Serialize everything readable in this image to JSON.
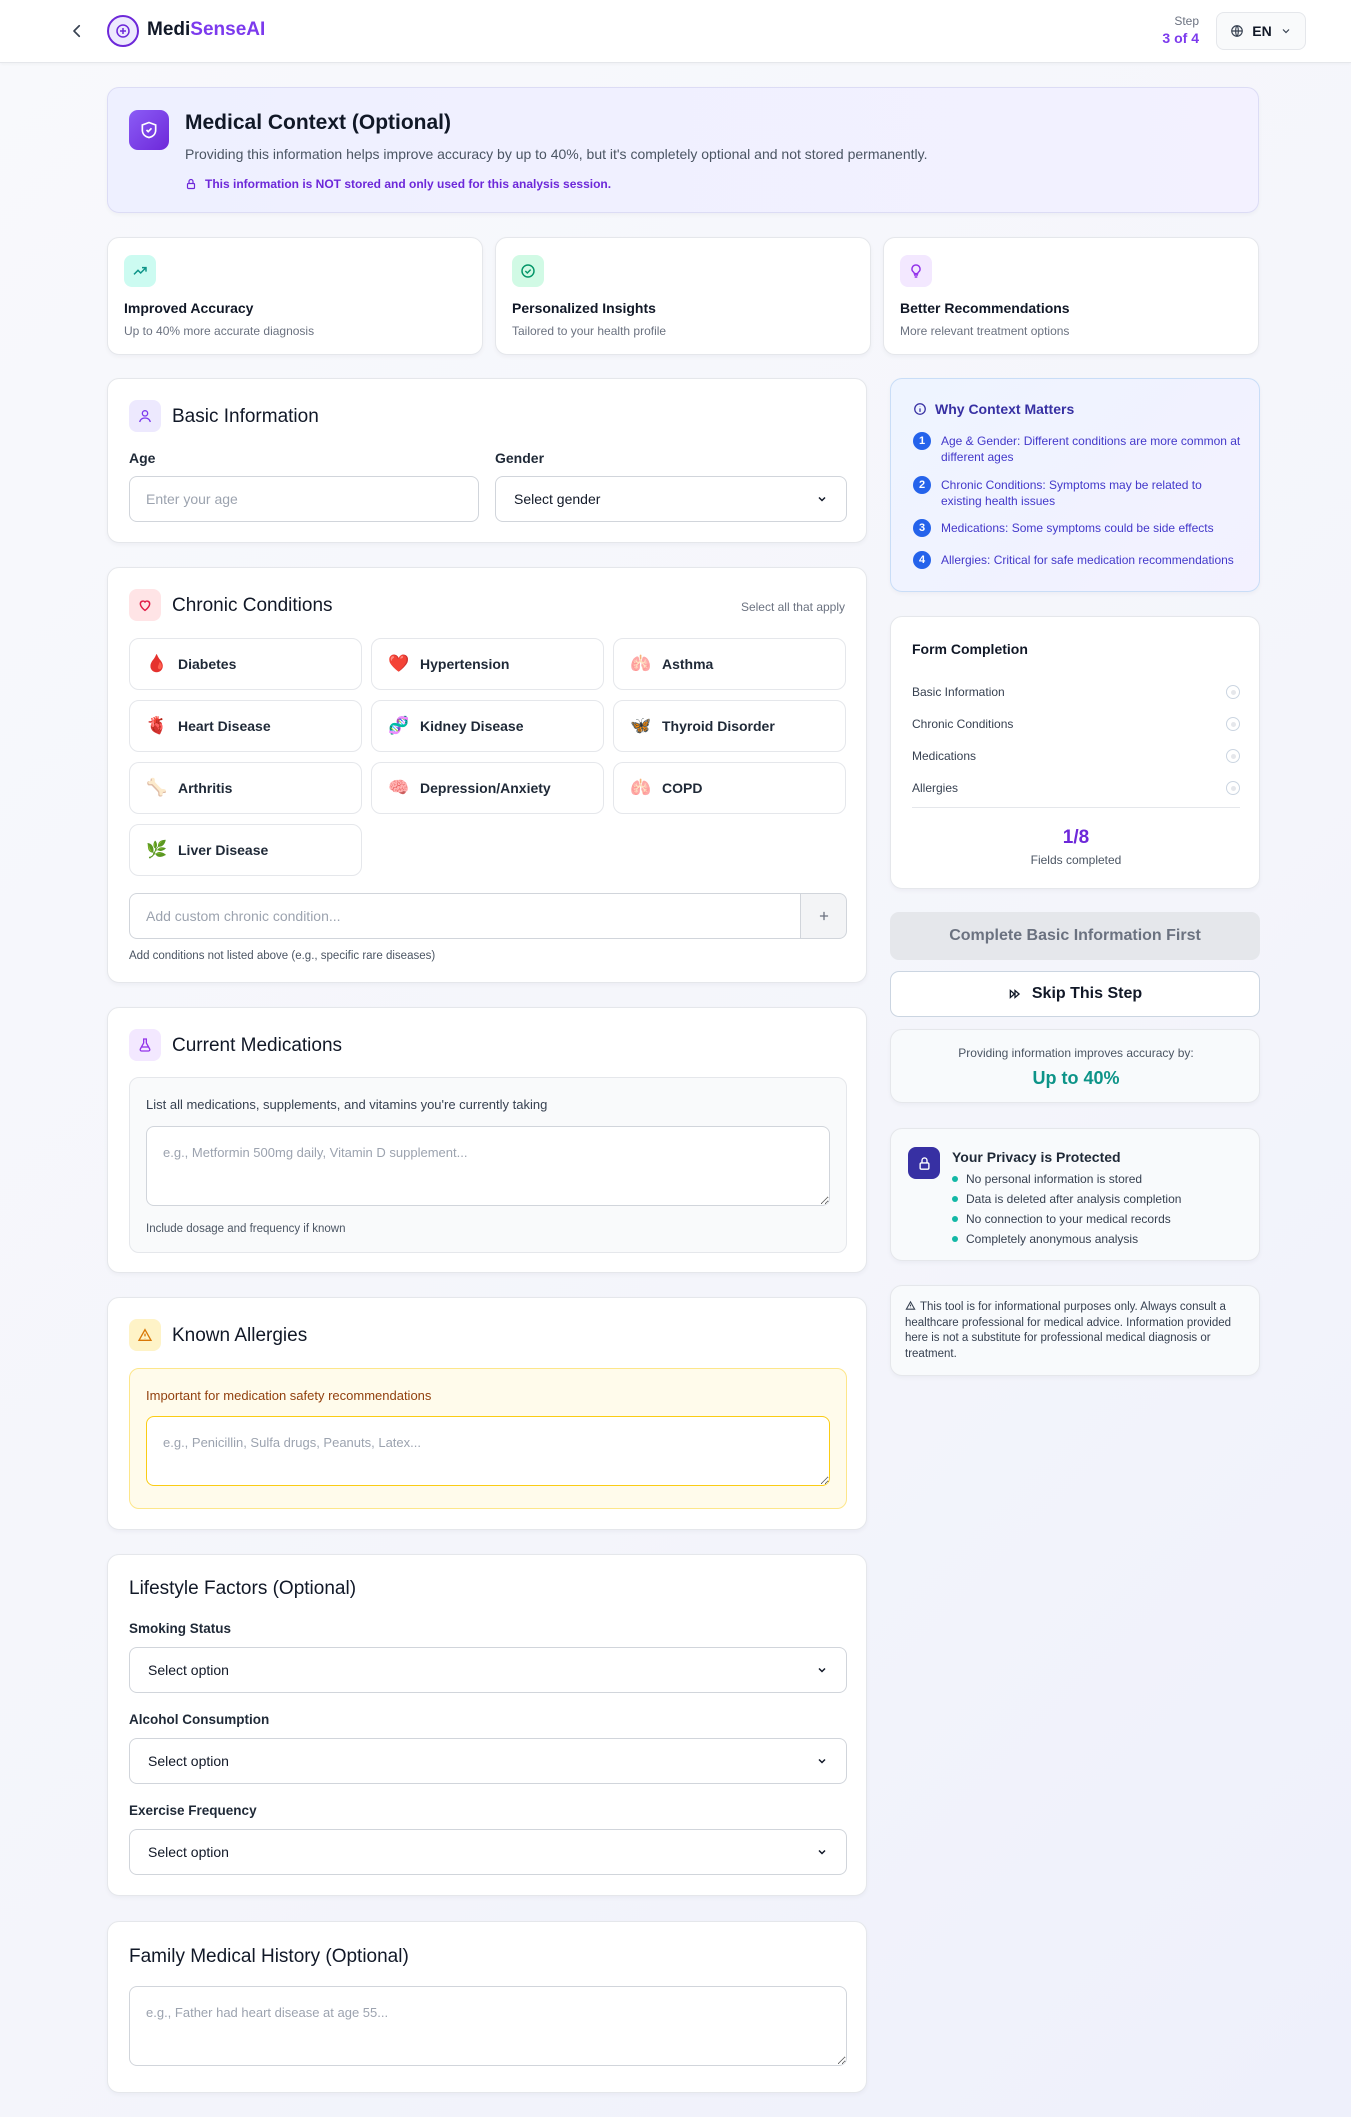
{
  "header": {
    "brand_part1": "Medi",
    "brand_part2": "SenseAI",
    "step_label": "Step",
    "step_value": "3 of 4",
    "language": "EN"
  },
  "hero": {
    "title": "Medical Context (Optional)",
    "description": "Providing this information helps improve accuracy by up to 40%, but it's completely optional and not stored permanently.",
    "note": "This information is NOT stored and only used for this analysis session."
  },
  "benefits": [
    {
      "title": "Improved Accuracy",
      "desc": "Up to 40% more accurate diagnosis",
      "icon": "trending-up-icon",
      "color": "#0d9488"
    },
    {
      "title": "Personalized Insights",
      "desc": "Tailored to your health profile",
      "icon": "check-circle-icon",
      "color": "#059669"
    },
    {
      "title": "Better Recommendations",
      "desc": "More relevant treatment options",
      "icon": "lightbulb-icon",
      "color": "#9333ea"
    }
  ],
  "basic": {
    "title": "Basic Information",
    "age_label": "Age",
    "age_placeholder": "Enter your age",
    "gender_label": "Gender",
    "gender_value": "Select gender"
  },
  "chronic": {
    "title": "Chronic Conditions",
    "hint": "Select all that apply",
    "items": [
      {
        "label": "Diabetes",
        "emoji": "🩸"
      },
      {
        "label": "Hypertension",
        "emoji": "❤️"
      },
      {
        "label": "Asthma",
        "emoji": "🫁"
      },
      {
        "label": "Heart Disease",
        "emoji": "🫀"
      },
      {
        "label": "Kidney Disease",
        "emoji": "🧬"
      },
      {
        "label": "Thyroid Disorder",
        "emoji": "🦋"
      },
      {
        "label": "Arthritis",
        "emoji": "🦴"
      },
      {
        "label": "Depression/Anxiety",
        "emoji": "🧠"
      },
      {
        "label": "COPD",
        "emoji": "🫁"
      },
      {
        "label": "Liver Disease",
        "emoji": "🌿"
      }
    ],
    "custom_placeholder": "Add custom chronic condition...",
    "custom_hint": "Add conditions not listed above (e.g., specific rare diseases)"
  },
  "medications": {
    "title": "Current Medications",
    "prompt": "List all medications, supplements, and vitamins you're currently taking",
    "placeholder": "e.g., Metformin 500mg daily, Vitamin D supplement...",
    "hint": "Include dosage and frequency if known"
  },
  "allergies": {
    "title": "Known Allergies",
    "prompt": "Important for medication safety recommendations",
    "placeholder": "e.g., Penicillin, Sulfa drugs, Peanuts, Latex..."
  },
  "lifestyle": {
    "title": "Lifestyle Factors (Optional)",
    "smoking_label": "Smoking Status",
    "alcohol_label": "Alcohol Consumption",
    "exercise_label": "Exercise Frequency",
    "select_value": "Select option"
  },
  "family": {
    "title": "Family Medical History (Optional)",
    "placeholder": "e.g., Father had heart disease at age 55..."
  },
  "why": {
    "title": "Why Context Matters",
    "items": [
      {
        "num": "1",
        "text": "Age & Gender: Different conditions are more common at different ages"
      },
      {
        "num": "2",
        "text": "Chronic Conditions: Symptoms may be related to existing health issues"
      },
      {
        "num": "3",
        "text": "Medications: Some symptoms could be side effects"
      },
      {
        "num": "4",
        "text": "Allergies: Critical for safe medication recommendations"
      }
    ]
  },
  "completion": {
    "title": "Form Completion",
    "items": [
      "Basic Information",
      "Chronic Conditions",
      "Medications",
      "Allergies"
    ],
    "count": "1/8",
    "count_label": "Fields completed"
  },
  "actions": {
    "primary": "Complete Basic Information First",
    "skip": "Skip This Step"
  },
  "accuracy": {
    "label": "Providing information improves accuracy by:",
    "value": "Up to 40%"
  },
  "privacy": {
    "title": "Your Privacy is Protected",
    "items": [
      "No personal information is stored",
      "Data is deleted after analysis completion",
      "No connection to your medical records",
      "Completely anonymous analysis"
    ]
  },
  "disclaimer": "This tool is for informational purposes only. Always consult a healthcare professional for medical advice. Information provided here is not a substitute for professional medical diagnosis or treatment.",
  "colors": {
    "primary": "#7c3aed",
    "accent": "#0d9488"
  }
}
